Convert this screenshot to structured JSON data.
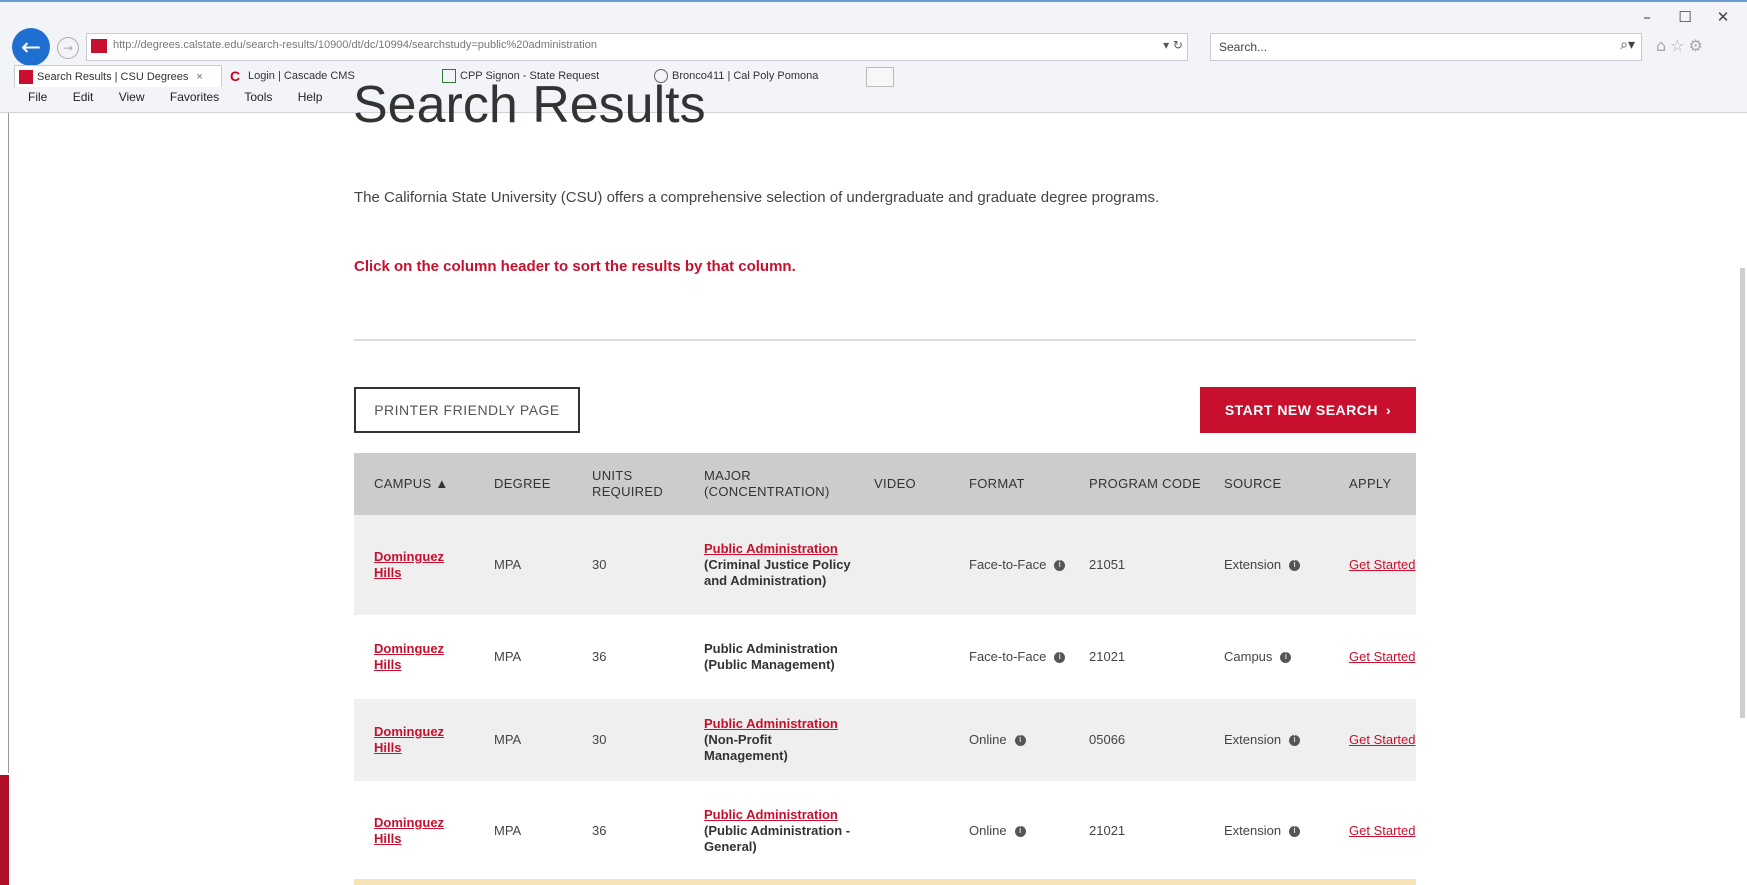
{
  "browser": {
    "url": "http://degrees.calstate.edu/search-results/10900/dt/dc/10994/searchstudy=public%20administration",
    "url_domain_bold": "calstate.edu",
    "search_placeholder": "Search...",
    "tabs": [
      {
        "label": "Search Results | CSU Degrees",
        "close": "×",
        "active": true,
        "favicon_color": "#c8102e"
      },
      {
        "label": "Login | Cascade CMS",
        "active": false,
        "favicon_color": "#d0021b"
      },
      {
        "label": "CPP Signon - State Request",
        "active": false,
        "favicon_color": "#2e7d32"
      },
      {
        "label": "Bronco411 | Cal Poly Pomona",
        "active": false,
        "favicon_color": "#666666"
      }
    ],
    "menu": [
      "File",
      "Edit",
      "View",
      "Favorites",
      "Tools",
      "Help"
    ],
    "window_controls": [
      "–",
      "☐",
      "✕"
    ]
  },
  "page": {
    "heading": "Search Results",
    "intro": "The California State University (CSU) offers a comprehensive selection of undergraduate and graduate degree programs.",
    "sort_hint": "Click on the column header to sort the results by that column.",
    "print_button": "PRINTER FRIENDLY PAGE",
    "start_button": "START NEW SEARCH",
    "accent_color": "#c8102e"
  },
  "table": {
    "headers": {
      "campus": "CAMPUS ▲",
      "degree": "DEGREE",
      "units": "UNITS REQUIRED",
      "major": "MAJOR (CONCENTRATION)",
      "video": "VIDEO",
      "format": "FORMAT",
      "code": "PROGRAM CODE",
      "source": "SOURCE",
      "apply": "APPLY"
    },
    "rows": [
      {
        "campus": "Dominguez Hills",
        "degree": "MPA",
        "units": "30",
        "major_link": "Public Administration",
        "concentration": "(Criminal Justice Policy and Administration)",
        "format": "Face-to-Face",
        "code": "21051",
        "source": "Extension",
        "apply": "Get Started"
      },
      {
        "campus": "Dominguez Hills",
        "degree": "MPA",
        "units": "36",
        "major_link": "",
        "major_plain": "Public Administration (Public Management)",
        "concentration": "",
        "format": "Face-to-Face",
        "code": "21021",
        "source": "Campus",
        "apply": "Get Started"
      },
      {
        "campus": "Dominguez Hills",
        "degree": "MPA",
        "units": "30",
        "major_link": "Public Administration",
        "concentration": "(Non-Profit Management)",
        "format": "Online",
        "code": "05066",
        "source": "Extension",
        "apply": "Get Started"
      },
      {
        "campus": "Dominguez Hills",
        "degree": "MPA",
        "units": "36",
        "major_link": "Public Administration",
        "concentration": "(Public Administration - General)",
        "format": "Online",
        "code": "21021",
        "source": "Extension",
        "apply": "Get Started"
      }
    ]
  }
}
